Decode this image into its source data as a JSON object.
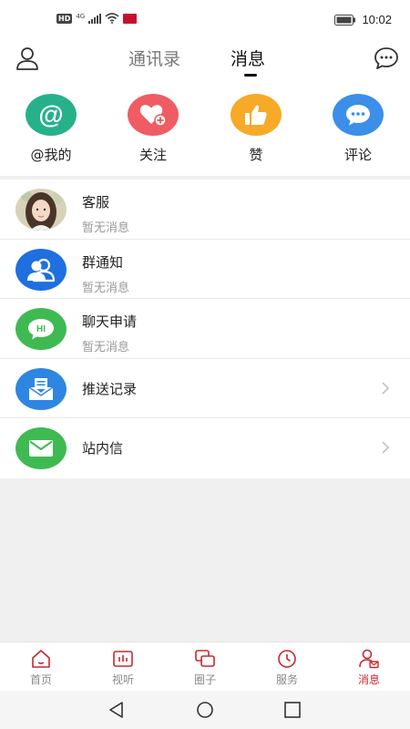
{
  "status_bar": {
    "hd_badge": "HD",
    "network_type": "4G",
    "time": "10:02"
  },
  "header": {
    "tabs": [
      {
        "label": "通讯录",
        "active": false
      },
      {
        "label": "消息",
        "active": true
      }
    ]
  },
  "quick_actions": [
    {
      "label": "@我的",
      "icon": "at-icon",
      "color": "#26b18b"
    },
    {
      "label": "关注",
      "icon": "heart-plus-icon",
      "color": "#f05c63"
    },
    {
      "label": "赞",
      "icon": "thumbs-up-icon",
      "color": "#f7a928"
    },
    {
      "label": "评论",
      "icon": "comment-icon",
      "color": "#3b8fe8"
    }
  ],
  "messages": [
    {
      "title": "客服",
      "subtitle": "暂无消息",
      "icon": "avatar-photo"
    },
    {
      "title": "群通知",
      "subtitle": "暂无消息",
      "icon": "group-icon",
      "color": "#1f6fe0"
    },
    {
      "title": "聊天申请",
      "subtitle": "暂无消息",
      "icon": "hi-bubble-icon",
      "color": "#3fba52"
    },
    {
      "title": "推送记录",
      "icon": "inbox-icon",
      "color": "#2f86e0"
    },
    {
      "title": "站内信",
      "icon": "envelope-icon",
      "color": "#3fba52"
    }
  ],
  "bottom_nav": [
    {
      "label": "首页",
      "icon": "home-icon",
      "active": false
    },
    {
      "label": "视听",
      "icon": "media-icon",
      "active": false
    },
    {
      "label": "圈子",
      "icon": "circle-chat-icon",
      "active": false
    },
    {
      "label": "服务",
      "icon": "clock-icon",
      "active": false
    },
    {
      "label": "消息",
      "icon": "message-user-icon",
      "active": true
    }
  ],
  "colors": {
    "accent": "#c7282e",
    "nav_inactive": "#8a8a8a"
  }
}
